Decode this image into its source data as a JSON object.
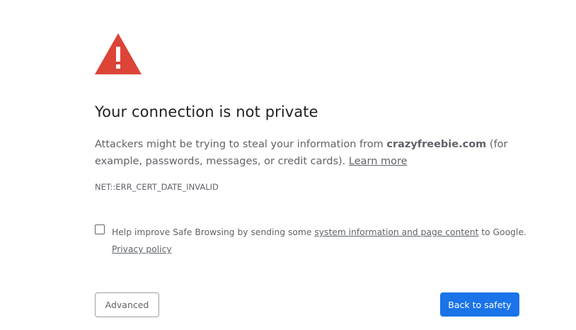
{
  "interstitial": {
    "icon": "warning-triangle-icon",
    "icon_color": "#db4437",
    "title": "Your connection is not private",
    "message_before": "Attackers might be trying to steal your information from ",
    "domain": "crazyfreebie.com",
    "message_after": " (for example, passwords, messages, or credit cards). ",
    "learn_more": "Learn more",
    "error_code": "NET::ERR_CERT_DATE_INVALID"
  },
  "safe_browsing": {
    "checked": false,
    "text_before": "Help improve Safe Browsing by sending some ",
    "link_label": "system information and page content",
    "text_after": " to Google.",
    "privacy_policy": "Privacy policy"
  },
  "buttons": {
    "advanced": "Advanced",
    "back_to_safety": "Back to safety",
    "primary_color": "#1a73e8"
  }
}
